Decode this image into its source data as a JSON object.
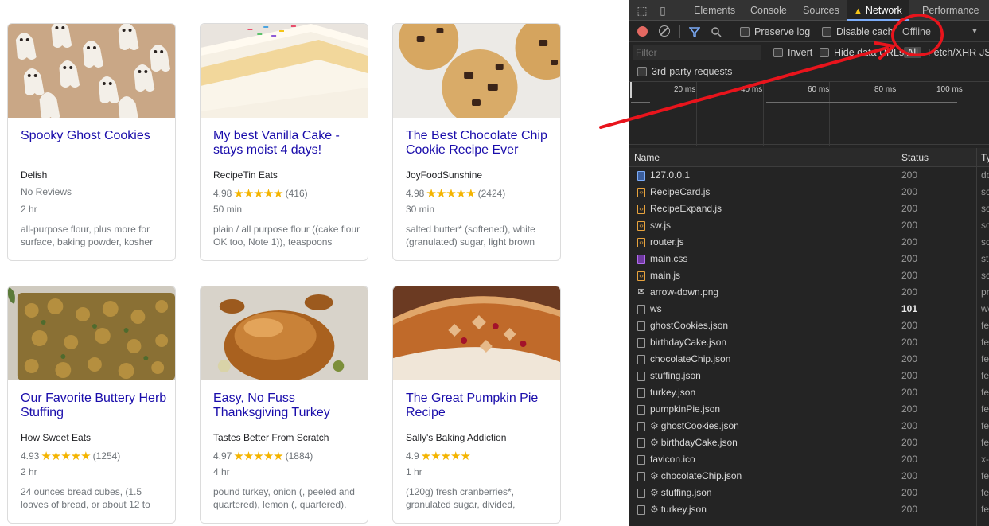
{
  "recipes": [
    {
      "title": "Spooky Ghost Cookies",
      "source": "Delish",
      "rating": "No Reviews",
      "stars": "",
      "reviews": "",
      "time": "2 hr",
      "ingredients": "all-purpose flour, plus more for surface, baking powder, kosher"
    },
    {
      "title": "My best Vanilla Cake - stays moist 4 days!",
      "source": "RecipeTin Eats",
      "rating": "4.98",
      "stars": "★★★★★",
      "reviews": "(416)",
      "time": "50 min",
      "ingredients": "plain / all purpose flour ((cake flour OK too, Note 1)), teaspoons"
    },
    {
      "title": "The Best Chocolate Chip Cookie Recipe Ever",
      "source": "JoyFoodSunshine",
      "rating": "4.98",
      "stars": "★★★★★",
      "reviews": "(2424)",
      "time": "30 min",
      "ingredients": "salted butter* (softened), white (granulated) sugar, light brown"
    },
    {
      "title": "Our Favorite Buttery Herb Stuffing",
      "source": "How Sweet Eats",
      "rating": "4.93",
      "stars": "★★★★★",
      "reviews": "(1254)",
      "time": "2 hr",
      "ingredients": "24 ounces bread cubes, (1.5 loaves of bread, or about 12 to"
    },
    {
      "title": "Easy, No Fuss Thanksgiving Turkey",
      "source": "Tastes Better From Scratch",
      "rating": "4.97",
      "stars": "★★★★★",
      "reviews": "(1884)",
      "time": "4 hr",
      "ingredients": "pound turkey, onion (, peeled and quartered), lemon (, quartered),"
    },
    {
      "title": "The Great Pumpkin Pie Recipe",
      "source": "Sally's Baking Addiction",
      "rating": "4.9",
      "stars": "★★★★★",
      "reviews": "",
      "time": "1 hr",
      "ingredients": "(120g) fresh cranberries*, granulated sugar, divided,"
    }
  ],
  "devtools": {
    "tabs": [
      "Elements",
      "Console",
      "Sources",
      "Network",
      "Performance"
    ],
    "active_tab": "Network",
    "toolbar": {
      "preserve_log": "Preserve log",
      "disable_cache": "Disable cach",
      "throttle": "Offline"
    },
    "filter": {
      "placeholder": "Filter",
      "invert": "Invert",
      "hide_data_urls": "Hide data URLs",
      "all": "All",
      "fetch_xhr": "Fetch/XHR",
      "js": "JS"
    },
    "third_party": "3rd-party requests",
    "timeline_ticks": [
      "20 ms",
      "40 ms",
      "60 ms",
      "80 ms",
      "100 ms"
    ],
    "columns": {
      "name": "Name",
      "status": "Status",
      "type": "Ty"
    },
    "rows": [
      {
        "name": "127.0.0.1",
        "status": "200",
        "type": "do",
        "icon": "doc",
        "gear": false
      },
      {
        "name": "RecipeCard.js",
        "status": "200",
        "type": "sc",
        "icon": "js",
        "gear": false
      },
      {
        "name": "RecipeExpand.js",
        "status": "200",
        "type": "sc",
        "icon": "js",
        "gear": false
      },
      {
        "name": "sw.js",
        "status": "200",
        "type": "sc",
        "icon": "js",
        "gear": false
      },
      {
        "name": "router.js",
        "status": "200",
        "type": "sc",
        "icon": "js",
        "gear": false
      },
      {
        "name": "main.css",
        "status": "200",
        "type": "st",
        "icon": "css",
        "gear": false
      },
      {
        "name": "main.js",
        "status": "200",
        "type": "sc",
        "icon": "js",
        "gear": false
      },
      {
        "name": "arrow-down.png",
        "status": "200",
        "type": "pr",
        "icon": "img",
        "gear": false
      },
      {
        "name": "ws",
        "status": "101",
        "type": "we",
        "icon": "blank",
        "gear": false
      },
      {
        "name": "ghostCookies.json",
        "status": "200",
        "type": "fe",
        "icon": "blank",
        "gear": false
      },
      {
        "name": "birthdayCake.json",
        "status": "200",
        "type": "fe",
        "icon": "blank",
        "gear": false
      },
      {
        "name": "chocolateChip.json",
        "status": "200",
        "type": "fe",
        "icon": "blank",
        "gear": false
      },
      {
        "name": "stuffing.json",
        "status": "200",
        "type": "fe",
        "icon": "blank",
        "gear": false
      },
      {
        "name": "turkey.json",
        "status": "200",
        "type": "fe",
        "icon": "blank",
        "gear": false
      },
      {
        "name": "pumpkinPie.json",
        "status": "200",
        "type": "fe",
        "icon": "blank",
        "gear": false
      },
      {
        "name": "ghostCookies.json",
        "status": "200",
        "type": "fe",
        "icon": "blank",
        "gear": true
      },
      {
        "name": "birthdayCake.json",
        "status": "200",
        "type": "fe",
        "icon": "blank",
        "gear": true
      },
      {
        "name": "favicon.ico",
        "status": "200",
        "type": "x-",
        "icon": "blank",
        "gear": false
      },
      {
        "name": "chocolateChip.json",
        "status": "200",
        "type": "fe",
        "icon": "blank",
        "gear": true
      },
      {
        "name": "stuffing.json",
        "status": "200",
        "type": "fe",
        "icon": "blank",
        "gear": true
      },
      {
        "name": "turkey.json",
        "status": "200",
        "type": "fe",
        "icon": "blank",
        "gear": true
      }
    ]
  },
  "colors": {
    "link": "#1a0dab",
    "star": "#f4b400",
    "annotation": "#e8141c",
    "devtools_bg": "#242424",
    "tab_active_underline": "#7cacf8"
  }
}
